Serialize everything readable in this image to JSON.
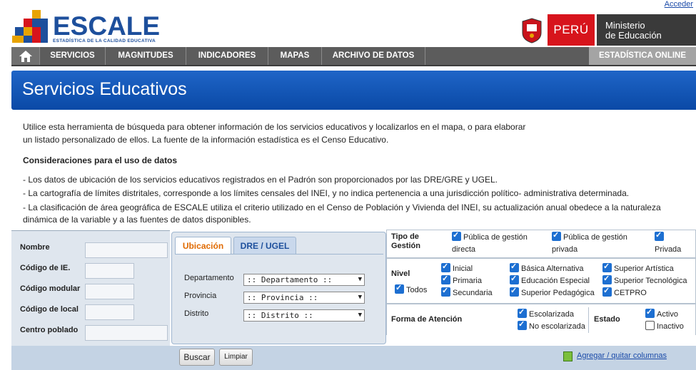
{
  "top": {
    "login_link": "Acceder"
  },
  "logo": {
    "name": "ESCALE",
    "tagline": "ESTADÍSTICA DE LA CALIDAD EDUCATIVA"
  },
  "gov": {
    "country": "PERÚ",
    "ministry_line1": "Ministerio",
    "ministry_line2": "de Educación"
  },
  "nav": {
    "items": [
      "SERVICIOS",
      "MAGNITUDES",
      "INDICADORES",
      "MAPAS",
      "ARCHIVO DE DATOS"
    ],
    "right": "ESTADÍSTICA ONLINE"
  },
  "page": {
    "title": "Servicios Educativos"
  },
  "intro": {
    "line1": "Utilice esta herramienta de búsqueda para obtener información de los servicios educativos y localizarlos en el mapa, o para elaborar",
    "line2": "un listado personalizado de ellos. La fuente de la información estadística es el Censo Educativo.",
    "heading": "Consideraciones para el uso de datos",
    "bullet1": "- Los datos de ubicación de los servicios educativos registrados en el Padrón son  proporcionados por las DRE/GRE y UGEL.",
    "bullet2": "- La cartografía de límites distritales, corresponde a los  límites censales del INEI, y no indica pertenencia a una jurisdicción político-   administrativa determinada.",
    "bullet3a": "- La clasificación de área geográfica de ESCALE utiliza el criterio utilizado en el Censo de Población y Vivienda del INEI, su actualización anual obedece a la naturaleza",
    "bullet3b": "dinámica de la variable y a las fuentes de datos disponibles."
  },
  "form": {
    "nombre": "Nombre",
    "codigo_ie": "Código de IE.",
    "codigo_modular": "Código modular",
    "codigo_local": "Código de local",
    "centro_poblado": "Centro poblado"
  },
  "tabs": {
    "ubicacion": "Ubicación",
    "dre": "DRE / UGEL",
    "departamento_label": "Departamento",
    "departamento_value": ":: Departamento ::",
    "provincia_label": "Provincia",
    "provincia_value": ":: Provincia ::",
    "distrito_label": "Distrito",
    "distrito_value": ":: Distrito ::"
  },
  "filters": {
    "tipo_gestion_label1": "Tipo de",
    "tipo_gestion_label2": "Gestión",
    "gestion_publica_directa_1": "Pública de gestión",
    "gestion_publica_directa_2": "directa",
    "gestion_publica_privada_1": "Pública de gestión",
    "gestion_publica_privada_2": "privada",
    "gestion_privada": "Privada",
    "nivel_label": "Nivel",
    "todos": "Todos",
    "inicial": "Inicial",
    "primaria": "Primaria",
    "secundaria": "Secundaria",
    "basica_alternativa": "Básica Alternativa",
    "educacion_especial": "Educación Especial",
    "superior_pedagogica": "Superior Pedagógica",
    "superior_artistica": "Superior Artística",
    "superior_tecnologica": "Superior Tecnológica",
    "cetpro": "CETPRO",
    "forma_atencion_label": "Forma de Atención",
    "escolarizada": "Escolarizada",
    "no_escolarizada": "No escolarizada",
    "estado_label": "Estado",
    "activo": "Activo",
    "inactivo": "Inactivo"
  },
  "actions": {
    "search": "Buscar",
    "clear": "Limpiar",
    "columns_link": "Agregar / quitar columnas"
  },
  "colors": {
    "brand_blue": "#1d4f9c",
    "banner_blue": "#0a49a6",
    "peru_red": "#d7141c",
    "tab_orange": "#e06a00"
  }
}
